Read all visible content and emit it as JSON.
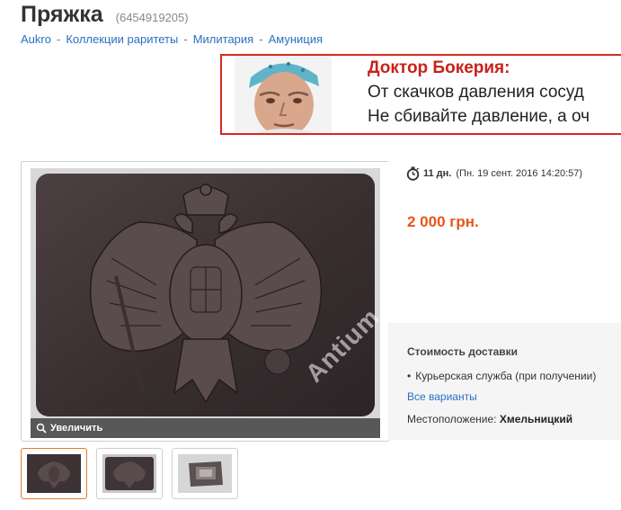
{
  "item": {
    "title": "Пряжка",
    "id": "(6454919205)"
  },
  "breadcrumb": [
    {
      "label": "Aukro"
    },
    {
      "label": "Коллекции раритеты"
    },
    {
      "label": "Милитария"
    },
    {
      "label": "Амуниция"
    }
  ],
  "breadcrumb_separator": "-",
  "ad": {
    "title": "Доктор Бокерия:",
    "line1": "От скачков давления сосуд",
    "line2": "Не сбивайте давление, а оч"
  },
  "gallery": {
    "zoom_label": "Увеличить",
    "watermark": "Antium",
    "thumbnails_count": 3,
    "active_thumbnail": 1
  },
  "auction": {
    "time_left": "11 дн.",
    "end_date": "(Пн. 19 сент. 2016 14:20:57)",
    "price": "2 000 грн."
  },
  "shipping": {
    "title": "Стоимость доставки",
    "method": "Курьерская служба (при получении)",
    "all_options": "Все варианты",
    "location_label": "Местоположение:",
    "location_value": "Хмельницкий"
  },
  "colors": {
    "price": "#e8541a",
    "link": "#2a6fc4",
    "ad_accent": "#c8211a",
    "active_thumb": "#e07a2c"
  },
  "icons": {
    "timer": "stopwatch-icon",
    "zoom": "magnifier-icon"
  }
}
